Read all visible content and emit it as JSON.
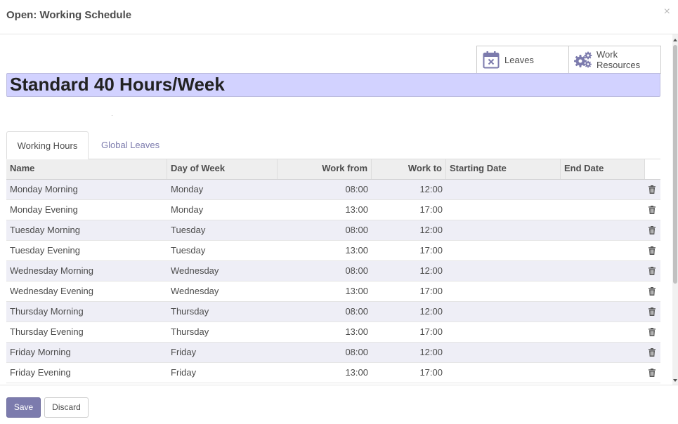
{
  "dialog": {
    "title": "Open: Working Schedule",
    "close_glyph": "×"
  },
  "button_box": {
    "leaves_label": "Leaves",
    "leaves_icon": "calendar-times-icon",
    "resources_label_1": "Work",
    "resources_label_2": "Resources",
    "resources_icon": "gears-icon"
  },
  "record": {
    "name": "Standard 40 Hours/Week"
  },
  "tabs": [
    {
      "label": "Working Hours",
      "active": true
    },
    {
      "label": "Global Leaves",
      "active": false
    }
  ],
  "grid": {
    "columns": [
      "Name",
      "Day of Week",
      "Work from",
      "Work to",
      "Starting Date",
      "End Date"
    ],
    "rows": [
      {
        "name": "Monday Morning",
        "day": "Monday",
        "from": "08:00",
        "to": "12:00",
        "start": "",
        "end": ""
      },
      {
        "name": "Monday Evening",
        "day": "Monday",
        "from": "13:00",
        "to": "17:00",
        "start": "",
        "end": ""
      },
      {
        "name": "Tuesday Morning",
        "day": "Tuesday",
        "from": "08:00",
        "to": "12:00",
        "start": "",
        "end": ""
      },
      {
        "name": "Tuesday Evening",
        "day": "Tuesday",
        "from": "13:00",
        "to": "17:00",
        "start": "",
        "end": ""
      },
      {
        "name": "Wednesday Morning",
        "day": "Wednesday",
        "from": "08:00",
        "to": "12:00",
        "start": "",
        "end": ""
      },
      {
        "name": "Wednesday Evening",
        "day": "Wednesday",
        "from": "13:00",
        "to": "17:00",
        "start": "",
        "end": ""
      },
      {
        "name": "Thursday Morning",
        "day": "Thursday",
        "from": "08:00",
        "to": "12:00",
        "start": "",
        "end": ""
      },
      {
        "name": "Thursday Evening",
        "day": "Thursday",
        "from": "13:00",
        "to": "17:00",
        "start": "",
        "end": ""
      },
      {
        "name": "Friday Morning",
        "day": "Friday",
        "from": "08:00",
        "to": "12:00",
        "start": "",
        "end": ""
      },
      {
        "name": "Friday Evening",
        "day": "Friday",
        "from": "13:00",
        "to": "17:00",
        "start": "",
        "end": ""
      }
    ]
  },
  "footer": {
    "save_label": "Save",
    "discard_label": "Discard"
  },
  "colors": {
    "brand": "#7c7bad",
    "title_bg": "#d2d2ff",
    "odd_row": "#eeeef6"
  }
}
